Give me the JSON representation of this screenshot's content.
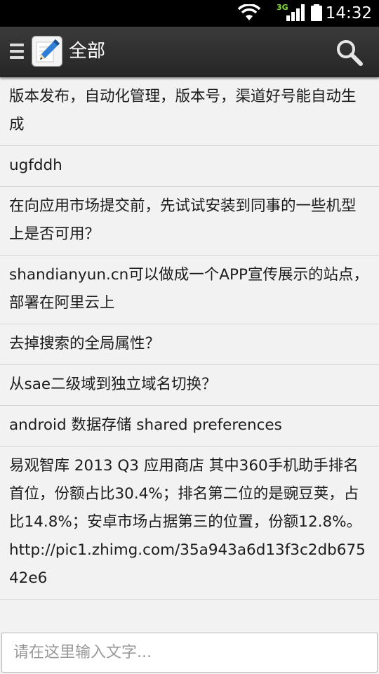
{
  "status_bar": {
    "network": "3G",
    "time": "14:32",
    "icons": [
      "wifi-icon",
      "signal-icon",
      "battery-icon"
    ]
  },
  "action_bar": {
    "menu_icon": "menu-icon",
    "app_icon": "pencil-notes-icon",
    "title": "全部",
    "search_icon": "search-icon"
  },
  "notes": [
    "版本发布，自动化管理，版本号，渠道好号能自动生成",
    "ugfddh",
    "在向应用市场提交前，先试试安装到同事的一些机型上是否可用？",
    "shandianyun.cn可以做成一个APP宣传展示的站点，部署在阿里云上",
    "去掉搜索的全局属性？",
    "从sae二级域到独立域名切换？",
    "android 数据存储 shared preferences",
    "易观智库 2013 Q3 应用商店 其中360手机助手排名首位，份额占比30.4%；排名第二位的是豌豆荚，占比14.8%；安卓市场占据第三的位置，份额12.8%。 http://pic1.zhimg.com/35a943a6d13f3c2db67542e6"
  ],
  "input": {
    "placeholder": "请在这里输入文字...",
    "value": ""
  },
  "colors": {
    "status_bar_bg": "#000000",
    "action_bar_bg": "#2f2f2f",
    "list_bg": "#f2f2f2",
    "divider": "#d6d6d6",
    "network_badge": "#7fdc3a"
  }
}
